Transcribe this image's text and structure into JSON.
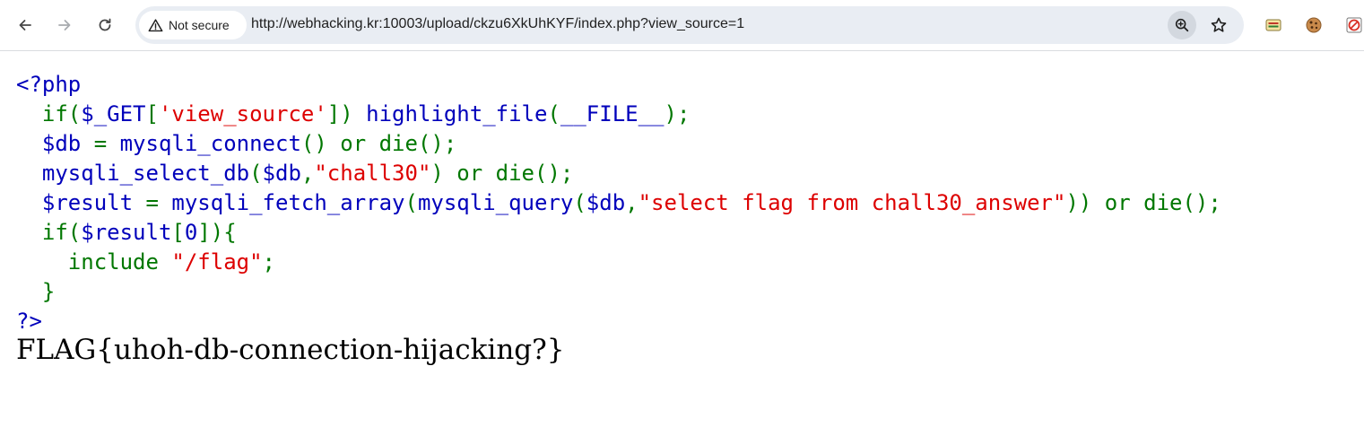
{
  "browser": {
    "security_label": "Not secure",
    "url": "http://webhacking.kr:10003/upload/ckzu6XkUhKYF/index.php?view_source=1",
    "icons": {
      "back": "arrow-left-icon",
      "forward": "arrow-right-icon",
      "reload": "reload-icon",
      "warning": "warning-triangle-icon",
      "zoom": "zoom-in-icon",
      "bookmark": "star-icon",
      "extensions": [
        "extension-badge-icon",
        "cookie-icon",
        "block-icon"
      ]
    }
  },
  "colors": {
    "php_default": "#0000bb",
    "php_keyword": "#007700",
    "php_string": "#dd0000"
  },
  "source": {
    "lines": [
      [
        {
          "t": "<?php",
          "c": "default"
        }
      ],
      [
        {
          "t": "  if(",
          "c": "keyword"
        },
        {
          "t": "$_GET",
          "c": "default"
        },
        {
          "t": "[",
          "c": "keyword"
        },
        {
          "t": "'view_source'",
          "c": "string"
        },
        {
          "t": "]) ",
          "c": "keyword"
        },
        {
          "t": "highlight_file",
          "c": "default"
        },
        {
          "t": "(",
          "c": "keyword"
        },
        {
          "t": "__FILE__",
          "c": "default"
        },
        {
          "t": ");",
          "c": "keyword"
        }
      ],
      [
        {
          "t": "  $db ",
          "c": "default"
        },
        {
          "t": "= ",
          "c": "keyword"
        },
        {
          "t": "mysqli_connect",
          "c": "default"
        },
        {
          "t": "() or die();",
          "c": "keyword"
        }
      ],
      [
        {
          "t": "  mysqli_select_db",
          "c": "default"
        },
        {
          "t": "(",
          "c": "keyword"
        },
        {
          "t": "$db",
          "c": "default"
        },
        {
          "t": ",",
          "c": "keyword"
        },
        {
          "t": "\"chall30\"",
          "c": "string"
        },
        {
          "t": ") or die();",
          "c": "keyword"
        }
      ],
      [
        {
          "t": "  $result ",
          "c": "default"
        },
        {
          "t": "= ",
          "c": "keyword"
        },
        {
          "t": "mysqli_fetch_array",
          "c": "default"
        },
        {
          "t": "(",
          "c": "keyword"
        },
        {
          "t": "mysqli_query",
          "c": "default"
        },
        {
          "t": "(",
          "c": "keyword"
        },
        {
          "t": "$db",
          "c": "default"
        },
        {
          "t": ",",
          "c": "keyword"
        },
        {
          "t": "\"select flag from chall30_answer\"",
          "c": "string"
        },
        {
          "t": ")) or die();",
          "c": "keyword"
        }
      ],
      [
        {
          "t": "  if(",
          "c": "keyword"
        },
        {
          "t": "$result",
          "c": "default"
        },
        {
          "t": "[",
          "c": "keyword"
        },
        {
          "t": "0",
          "c": "default"
        },
        {
          "t": "]){",
          "c": "keyword"
        }
      ],
      [
        {
          "t": "    include ",
          "c": "keyword"
        },
        {
          "t": "\"/flag\"",
          "c": "string"
        },
        {
          "t": ";",
          "c": "keyword"
        }
      ],
      [
        {
          "t": "  }",
          "c": "keyword"
        }
      ],
      [
        {
          "t": "?>",
          "c": "default"
        }
      ]
    ]
  },
  "flag_text": "FLAG{uhoh-db-connection-hijacking?}"
}
